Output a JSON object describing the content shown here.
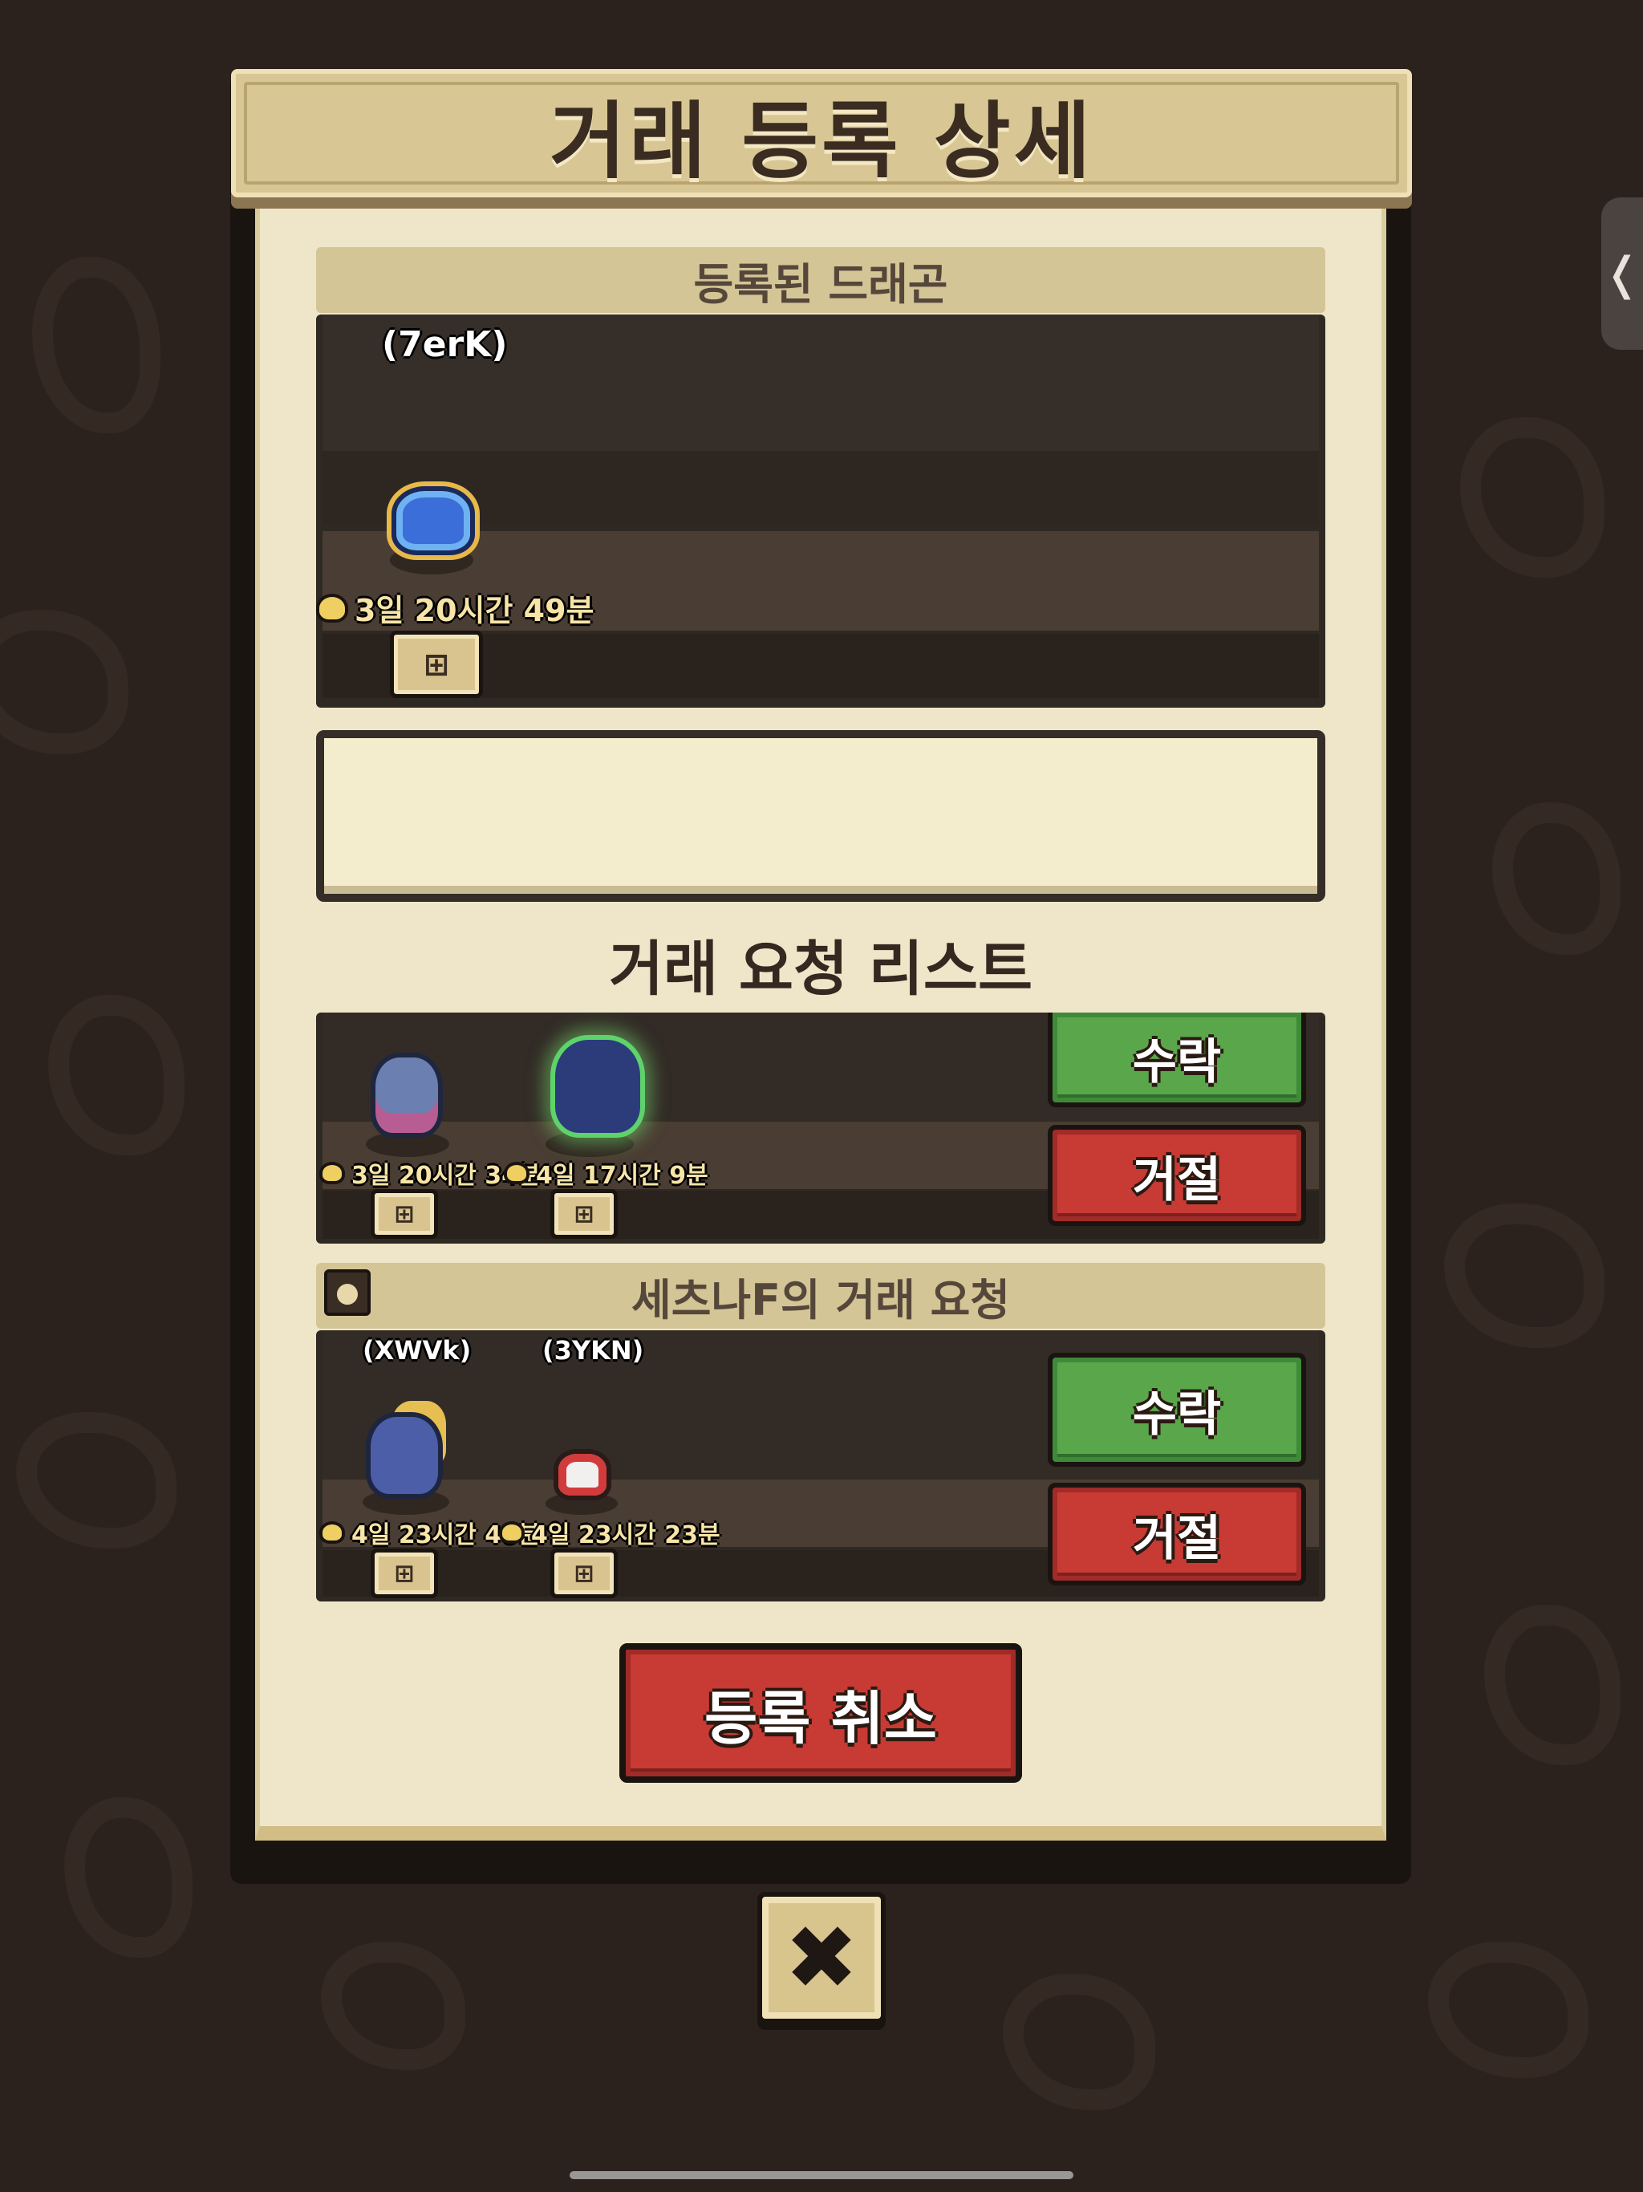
{
  "title": "거래 등록 상세",
  "registered_section": {
    "header": "등록된 드래곤",
    "dragon": {
      "code": "(7erK)",
      "timer": "3일 20시간 49분",
      "icon": "dragon-blue-icon"
    }
  },
  "list_title": "거래 요청 리스트",
  "requests": [
    {
      "header": "",
      "dragons": [
        {
          "code": "",
          "timer": "3일 20시간 34분"
        },
        {
          "code": "",
          "timer": "4일 17시간 9분"
        }
      ],
      "accept_label": "수락",
      "reject_label": "거절"
    },
    {
      "header": "세츠나F의 거래 요청",
      "dragons": [
        {
          "code": "(XWVk)",
          "timer": "4일 23시간 48분"
        },
        {
          "code": "(3YKN)",
          "timer": "4일 23시간 23분"
        }
      ],
      "accept_label": "수락",
      "reject_label": "거절"
    }
  ],
  "cancel_label": "등록 취소",
  "close_label": "✖",
  "side_tab_label": "❬",
  "mini_btn_label": "⊞",
  "colors": {
    "accept": "#5aa74b",
    "reject": "#c83a34",
    "panel": "#efe6c9",
    "dark": "#2f2924"
  }
}
